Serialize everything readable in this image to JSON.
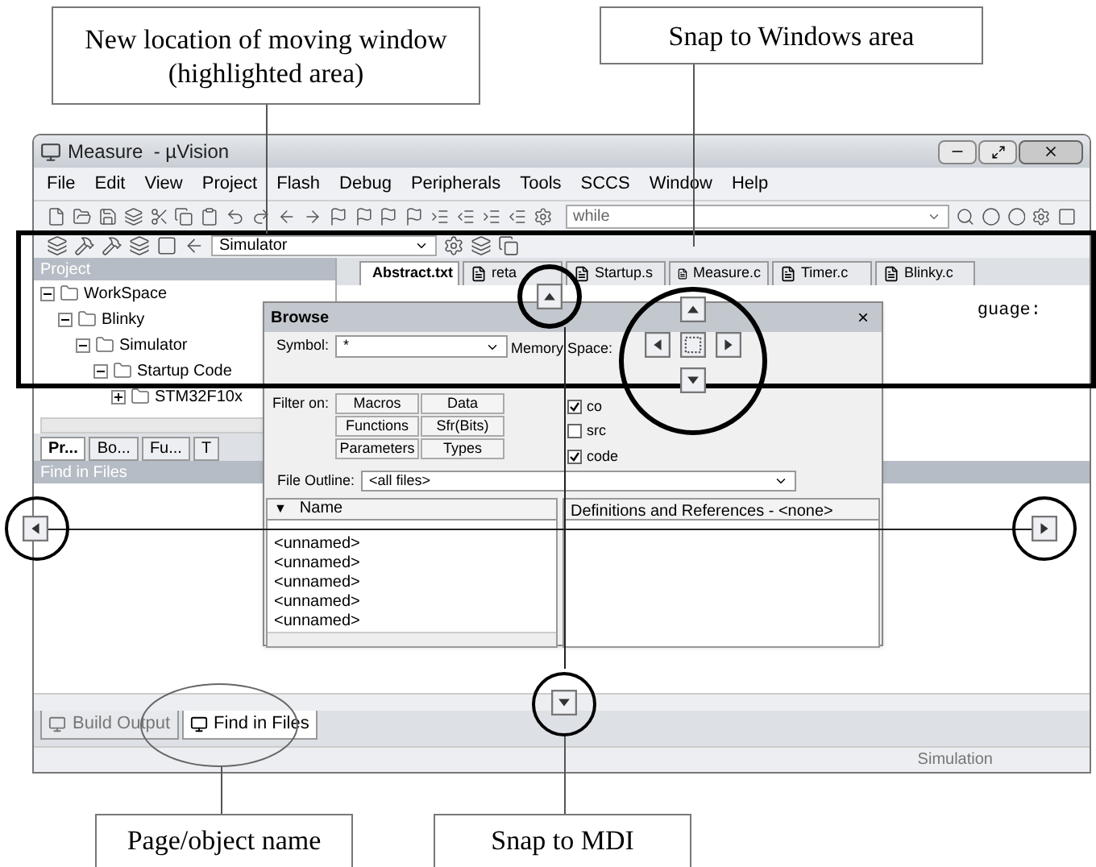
{
  "callouts_top": [
    {
      "text": "New location of moving window (highlighted area)"
    },
    {
      "text": "Snap to Windows area"
    }
  ],
  "callouts_bottom": [
    {
      "text": "Page/object name"
    },
    {
      "text": "Snap to MDI"
    }
  ],
  "window": {
    "title": "Measure  - µVision",
    "menu": [
      "File",
      "Edit",
      "View",
      "Project",
      "Flash",
      "Debug",
      "Peripherals",
      "Tools",
      "SCCS",
      "Window",
      "Help"
    ],
    "find_combo": {
      "value": "while"
    },
    "target_combo": {
      "value": "Simulator"
    },
    "project_panel": {
      "title": "Project",
      "tree": [
        {
          "label": "WorkSpace",
          "expanded": true,
          "children": [
            {
              "label": "Blinky",
              "expanded": true,
              "children": [
                {
                  "label": "Simulator",
                  "expanded": true,
                  "children": [
                    {
                      "label": "Startup Code",
                      "expanded": true,
                      "children": [
                        {
                          "label": "STM32F10x",
                          "expanded": false
                        }
                      ]
                    }
                  ]
                }
              ]
            }
          ]
        }
      ],
      "tabs": [
        {
          "label": "Pr...",
          "selected": true
        },
        {
          "label": "Bo...",
          "selected": false
        },
        {
          "label": "Fu...",
          "selected": false
        },
        {
          "label": "T",
          "selected": false
        }
      ]
    },
    "editor": {
      "tabs": [
        {
          "label": "Abstract.txt",
          "selected": true
        },
        {
          "label": "reta",
          "selected": false
        },
        {
          "label": "Startup.s",
          "selected": false
        },
        {
          "label": "Measure.c",
          "selected": false
        },
        {
          "label": "Timer.c",
          "selected": false
        },
        {
          "label": "Blinky.c",
          "selected": false
        }
      ],
      "text": "guage:"
    },
    "find_panel": {
      "title": "Find in Files"
    },
    "bottom_tabs": [
      {
        "label": "Build Output",
        "selected": false
      },
      {
        "label": "Find in Files",
        "selected": true
      }
    ],
    "status_bar": {
      "mode": "Simulation"
    }
  },
  "browse_dialog": {
    "title": "Browse",
    "close": "×",
    "symbol_label": "Symbol:",
    "symbol_value": "*",
    "memory_label": "Memory Space:",
    "filter_label": "Filter on:",
    "filters": [
      "Macros",
      "Data",
      "Functions",
      "Sfr(Bits)",
      "Parameters",
      "Types"
    ],
    "options": [
      {
        "label": "co",
        "checked": true
      },
      {
        "label": "src",
        "checked": false
      },
      {
        "label": "code",
        "checked": true
      }
    ],
    "outline_label": "File Outline:",
    "outline_value": "<all files>",
    "sort_marker": "▼",
    "name_column": "Name",
    "names": [
      "<unnamed>",
      "<unnamed>",
      "<unnamed>",
      "<unnamed>",
      "<unnamed>"
    ],
    "definitions_column": "Definitions and References - <none>"
  }
}
